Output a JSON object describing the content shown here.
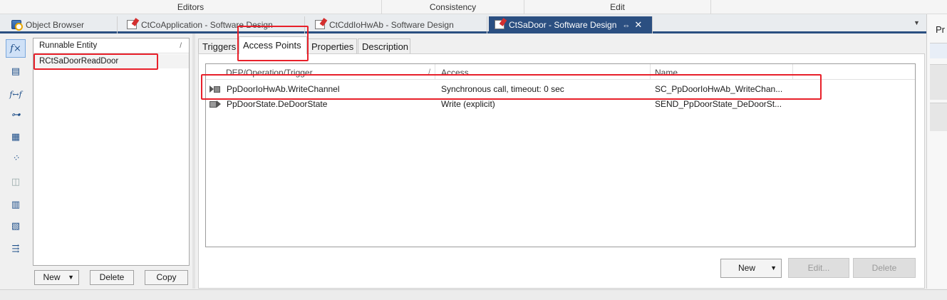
{
  "ribbon_groups": [
    "Editors",
    "Consistency",
    "Edit"
  ],
  "doc_tabs": [
    {
      "label": "Object Browser",
      "icon": "object-browser-icon",
      "active": false
    },
    {
      "label": "CtCoApplication - Software Design",
      "icon": "software-design-icon",
      "active": false
    },
    {
      "label": "CtCddIoHwAb - Software Design",
      "icon": "software-design-icon",
      "active": false
    },
    {
      "label": "CtSaDoor - Software Design",
      "icon": "software-design-icon",
      "active": true
    }
  ],
  "active_tab_controls": {
    "pin": "⇔",
    "close": "✕"
  },
  "left_toolbar": [
    {
      "icon": "runnable-function-icon",
      "glyph": "f×",
      "selected": true
    },
    {
      "icon": "port-interface-icon",
      "glyph": "▤"
    },
    {
      "icon": "function-mapping-icon",
      "glyph": "f↔f"
    },
    {
      "icon": "slider-parameter-icon",
      "glyph": "⊶"
    },
    {
      "icon": "data-mapping-icon",
      "glyph": "▦"
    },
    {
      "icon": "inter-runnable-icon",
      "glyph": "⁘"
    },
    {
      "icon": "component-icon",
      "glyph": "◫"
    },
    {
      "icon": "port-prototype-icon",
      "glyph": "▥"
    },
    {
      "icon": "calibration-icon",
      "glyph": "▧"
    },
    {
      "icon": "connector-icon",
      "glyph": "⇶"
    }
  ],
  "runnable_list": {
    "header": "Runnable Entity",
    "sort_glyph": "/",
    "items": [
      "RCtSaDoorReadDoor"
    ],
    "buttons": {
      "new": "New",
      "delete": "Delete",
      "copy": "Copy"
    }
  },
  "sub_tabs": [
    "Triggers",
    "Access Points",
    "Properties",
    "Description"
  ],
  "active_sub_tab": "Access Points",
  "access_points": {
    "columns": [
      "DEP/Operation/Trigger",
      "Access",
      "Name"
    ],
    "sort_glyph": "/",
    "rows": [
      {
        "icon": "client-server-port-icon",
        "dep": "PpDoorIoHwAb.WriteChannel",
        "access": "Synchronous call, timeout: 0 sec",
        "name": "SC_PpDoorIoHwAb_WriteChan..."
      },
      {
        "icon": "sender-port-icon",
        "dep": "PpDoorState.DeDoorState",
        "access": "Write (explicit)",
        "name": "SEND_PpDoorState_DeDoorSt..."
      }
    ],
    "buttons": {
      "new": "New",
      "edit": "Edit...",
      "delete": "Delete"
    }
  },
  "right_panel": {
    "title": "Pr"
  }
}
